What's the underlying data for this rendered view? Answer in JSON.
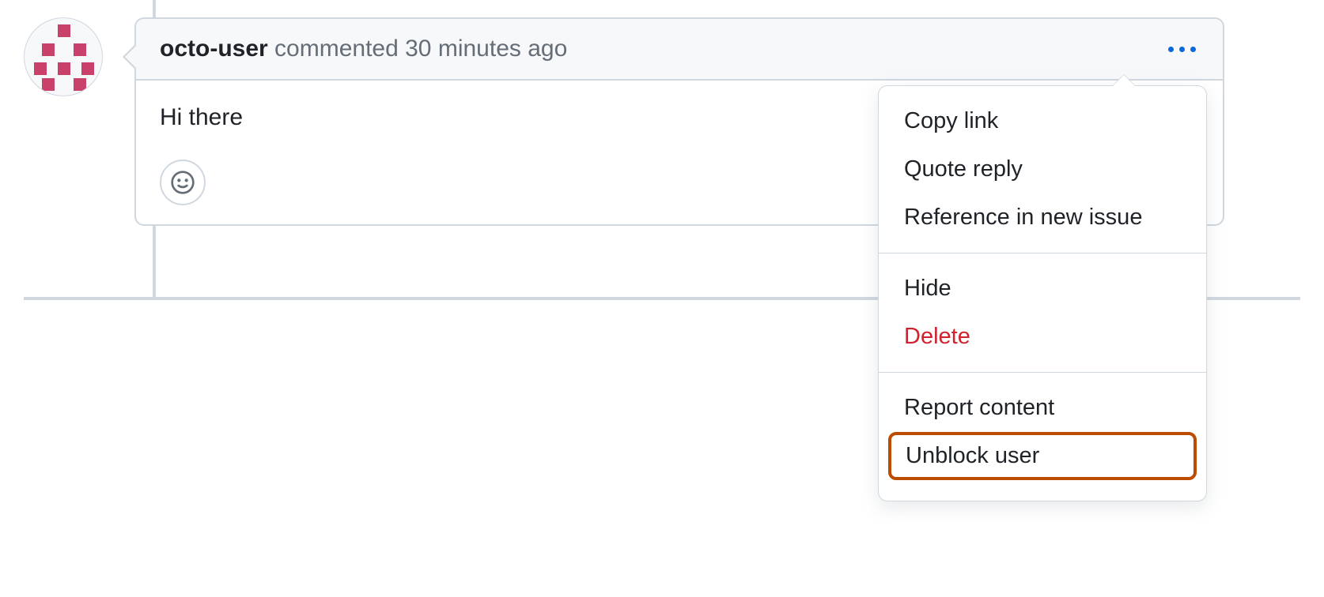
{
  "comment": {
    "username": "octo-user",
    "action_text": "commented",
    "timestamp": "30 minutes ago",
    "body_text": "Hi there"
  },
  "menu": {
    "section1": {
      "copy_link": "Copy link",
      "quote_reply": "Quote reply",
      "reference_issue": "Reference in new issue"
    },
    "section2": {
      "hide": "Hide",
      "delete": "Delete"
    },
    "section3": {
      "report_content": "Report content",
      "unblock_user": "Unblock user"
    }
  }
}
